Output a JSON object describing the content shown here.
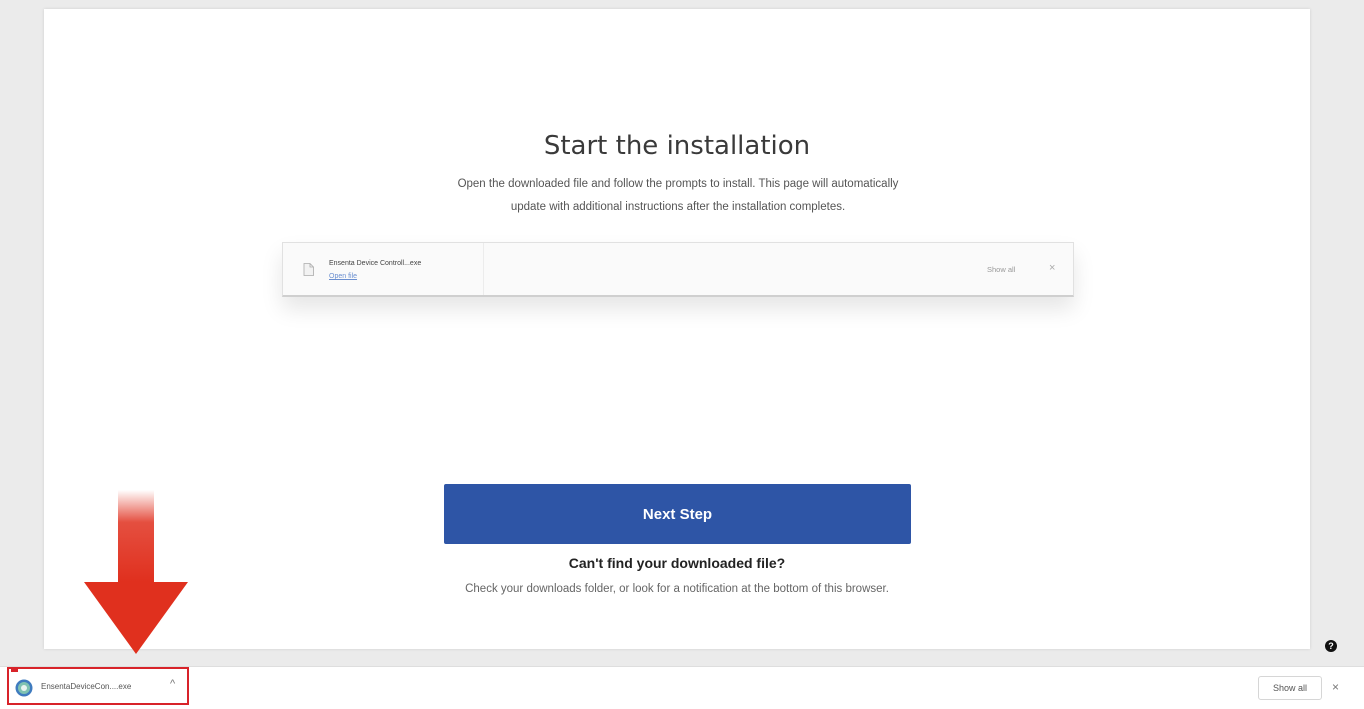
{
  "page": {
    "title": "Start the installation",
    "subtitle_line1": "Open the downloaded file and follow the prompts to install. This page will automatically",
    "subtitle_line2": "update with additional instructions after the installation completes."
  },
  "download_preview": {
    "file_name": "Ensenta Device Controll...exe",
    "open_label": "Open file",
    "show_all_label": "Show all",
    "close_symbol": "×"
  },
  "actions": {
    "next_label": "Next Step"
  },
  "help": {
    "title": "Can't find your downloaded file?",
    "text": "Check your downloads folder, or look for a notification at the bottom of this browser.",
    "badge": "?"
  },
  "download_bar": {
    "file_name": "EnsentaDeviceCon....exe",
    "chevron": "^",
    "show_all_label": "Show all",
    "close_symbol": "×"
  },
  "icons": {
    "preview_file": "file-icon",
    "bar_app": "app-icon",
    "arrow": "down-arrow-icon"
  },
  "colors": {
    "primary_button": "#2e55a6",
    "highlight": "#d8232a",
    "arrow": "#e0301e",
    "link": "#6b8fd0"
  }
}
